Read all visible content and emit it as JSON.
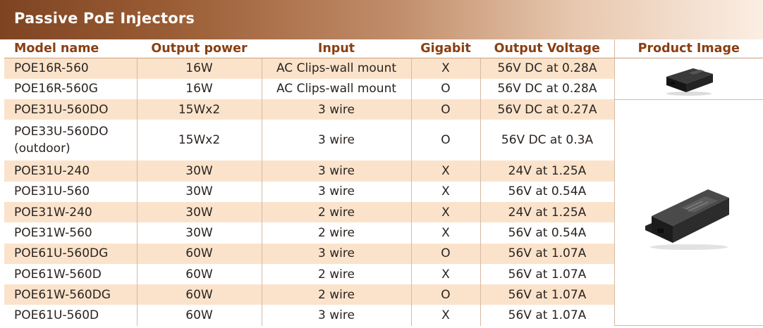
{
  "title": "Passive PoE Injectors",
  "columns": [
    "Model name",
    "Output power",
    "Input",
    "Gigabit",
    "Output Voltage",
    "Product Image"
  ],
  "rows": [
    {
      "model": "POE16R-560",
      "power": "16W",
      "input": "AC Clips-wall mount",
      "gigabit": "X",
      "voltage": "56V DC at 0.28A"
    },
    {
      "model": "POE16R-560G",
      "power": "16W",
      "input": "AC Clips-wall mount",
      "gigabit": "O",
      "voltage": "56V DC at 0.28A"
    },
    {
      "model": "POE31U-560DO",
      "power": "15Wx2",
      "input": "3 wire",
      "gigabit": "O",
      "voltage": "56V DC at 0.27A"
    },
    {
      "model": "POE33U-560DO (outdoor)",
      "power": "15Wx2",
      "input": "3 wire",
      "gigabit": "O",
      "voltage": "56V DC at 0.3A"
    },
    {
      "model": "POE31U-240",
      "power": "30W",
      "input": "3 wire",
      "gigabit": "X",
      "voltage": "24V at 1.25A"
    },
    {
      "model": "POE31U-560",
      "power": "30W",
      "input": "3 wire",
      "gigabit": "X",
      "voltage": "56V at 0.54A"
    },
    {
      "model": "POE31W-240",
      "power": "30W",
      "input": "2 wire",
      "gigabit": "X",
      "voltage": "24V at 1.25A"
    },
    {
      "model": "POE31W-560",
      "power": "30W",
      "input": "2 wire",
      "gigabit": "X",
      "voltage": "56V at 0.54A"
    },
    {
      "model": "POE61U-560DG",
      "power": "60W",
      "input": "3 wire",
      "gigabit": "O",
      "voltage": "56V at 1.07A"
    },
    {
      "model": "POE61W-560D",
      "power": "60W",
      "input": "2 wire",
      "gigabit": "X",
      "voltage": "56V at 1.07A"
    },
    {
      "model": "POE61W-560DG",
      "power": "60W",
      "input": "2 wire",
      "gigabit": "O",
      "voltage": "56V at 1.07A"
    },
    {
      "model": "POE61U-560D",
      "power": "60W",
      "input": "3 wire",
      "gigabit": "X",
      "voltage": "56V at 1.07A"
    }
  ],
  "images": [
    "small-poe-injector-image",
    "large-poe-injector-image"
  ]
}
